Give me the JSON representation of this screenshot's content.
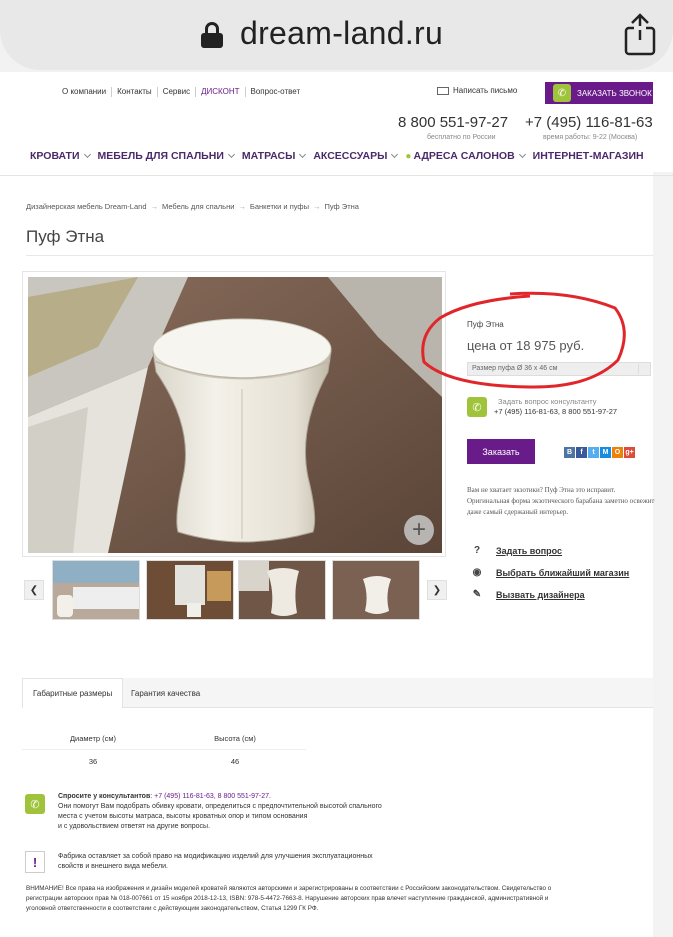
{
  "browser": {
    "url": "dream-land.ru"
  },
  "topnav": {
    "links": [
      "О компании",
      "Контакты",
      "Сервис",
      "ДИСКОНТ",
      "Вопрос-ответ"
    ],
    "write_letter": "Написать письмо",
    "callback": "ЗАКАЗАТЬ ЗВОНОК"
  },
  "contacts": {
    "phone1": "8 800 551-97-27",
    "phone1_note": "бесплатно по России",
    "phone2": "+7 (495) 116-81-63",
    "phone2_note": "время работы: 9-22 (Москва)"
  },
  "mainnav": [
    "КРОВАТИ",
    "МЕБЕЛЬ ДЛЯ СПАЛЬНИ",
    "МАТРАСЫ",
    "АКСЕССУАРЫ",
    "АДРЕСА САЛОНОВ",
    "ИНТЕРНЕТ-МАГАЗИН"
  ],
  "breadcrumb": [
    "Дизайнерская мебель Dream-Land",
    "Мебель для спальни",
    "Банкетки и пуфы",
    "Пуф Этна"
  ],
  "page_title": "Пуф Этна",
  "product": {
    "name": "Пуф Этна",
    "price": "цена от 18 975 руб.",
    "size_option": "Размер пуфа Ø 36 x 46 см",
    "consult_label": "Задать вопрос консультанту",
    "consult_phones": "+7 (495) 116-81-63, 8 800 551-97-27",
    "order_label": "Заказать",
    "description": "Вам не хватает экзотики? Пуф Этна это исправит. Оригинальная форма экзотического барабана заметно освежит даже самый сдержаный интерьер."
  },
  "socials": [
    "В",
    "f",
    "t",
    "М",
    "О",
    "g+"
  ],
  "actions": [
    {
      "icon": "?",
      "label": "Задать вопрос"
    },
    {
      "icon": "◉",
      "label": "Выбрать ближайший магазин"
    },
    {
      "icon": "✎",
      "label": "Вызвать дизайнера"
    }
  ],
  "tabs": [
    "Габаритные размеры",
    "Гарантия качества"
  ],
  "dimensions": {
    "headers": [
      "Диаметр (см)",
      "Высота (см)"
    ],
    "values": [
      "36",
      "46"
    ]
  },
  "ask": {
    "bold": "Спросите у консультантов",
    "phones": "+7 (495) 116-81-63, 8 800 551-97-27.",
    "line1": "Они помогут Вам подобрать обивку кровати, определиться с предпочтительной высотой спального",
    "line2": "места с учетом высоты матраса, высоты кроватных опор и типом основания",
    "line3": "и с удовольствием ответят на другие вопросы."
  },
  "warn": {
    "line1": "Фабрика оставляет за собой право на модификацию изделий для улучшения эксплуатационных",
    "line2": "свойств и внешнего вида мебели."
  },
  "legal": {
    "line1": "ВНИМАНИЕ! Все права на изображения и дизайн моделей кроватей являются авторскими и зарегистрированы в соответствии с Российским законодательством. Свидетельство о",
    "line2": "регистрации авторских прав № 018-007661 от 15 ноября 2018-12-13, ISBN: 978-5-4472-7663-8. Нарушение авторских прав влечет наступление гражданской, административной и",
    "line3": "уголовной ответственности в соответствии с действующим законодательством, Статья 1299 ГК РФ."
  },
  "colors": {
    "brand": "#6a1b8a",
    "accent_green": "#9fc33b",
    "annotation": "#e0262a"
  }
}
